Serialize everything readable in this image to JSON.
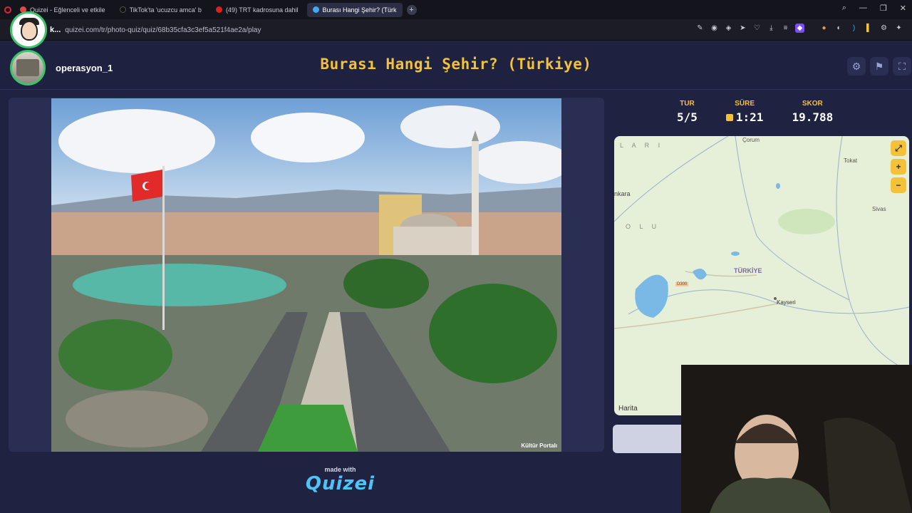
{
  "browser": {
    "tabs": [
      {
        "label": "Quizei - Eğlenceli ve etkile",
        "color": "#e34848"
      },
      {
        "label": "TikTok'ta 'ucuzcu amca' b",
        "color": "#222"
      },
      {
        "label": "(49) TRT kadrosuna dahil",
        "color": "#e02020"
      },
      {
        "label": "Burası Hangi Şehir? (Türk",
        "color": "#3fa9f5",
        "active": true
      }
    ],
    "new_tab": "+",
    "url_prefix": "k...",
    "url": "quizei.com/tr/photo-quiz/quiz/68b35cfa3c3ef5a521f4ae2a/play"
  },
  "header": {
    "username": "operasyon_1",
    "title": "Burası Hangi Şehir? (Türkiye)"
  },
  "stats": {
    "round_label": "TUR",
    "round_value": "5/5",
    "time_label": "SÜRE",
    "time_value": "1:21",
    "score_label": "SKOR",
    "score_value": "19.788"
  },
  "map": {
    "labels": {
      "corum": "Çorum",
      "tokat": "Tokat",
      "sivas": "Sivas",
      "ankara": "nkara",
      "country": "TÜRKİYE",
      "kayseri": "Kayseri",
      "road": "D300",
      "region1": "O L U",
      "region2": "L A R I"
    },
    "credit": "Harita"
  },
  "footer": {
    "made_with": "made with",
    "brand": "Quizei"
  },
  "photo": {
    "watermark": "Kültür Portalı"
  }
}
